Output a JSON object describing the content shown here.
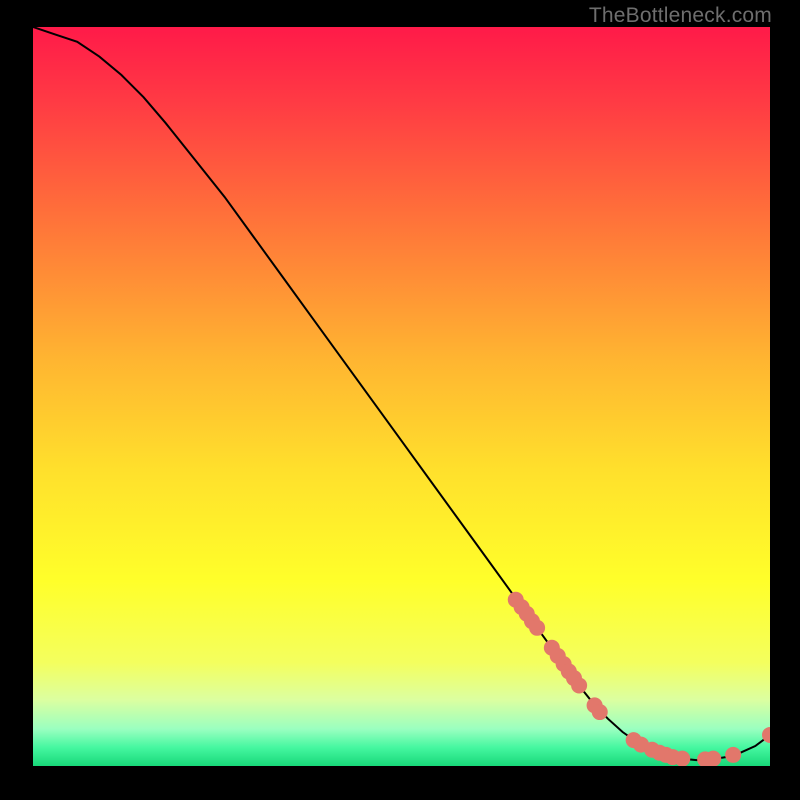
{
  "watermark": "TheBottleneck.com",
  "chart_data": {
    "type": "line",
    "title": "",
    "xlabel": "",
    "ylabel": "",
    "xlim": [
      0,
      100
    ],
    "ylim": [
      0,
      100
    ],
    "background_gradient": {
      "stops": [
        {
          "offset": 0.0,
          "color": "#ff1a49"
        },
        {
          "offset": 0.1,
          "color": "#ff3a44"
        },
        {
          "offset": 0.25,
          "color": "#ff6f3a"
        },
        {
          "offset": 0.45,
          "color": "#ffb531"
        },
        {
          "offset": 0.6,
          "color": "#ffe02c"
        },
        {
          "offset": 0.75,
          "color": "#ffff2a"
        },
        {
          "offset": 0.86,
          "color": "#f4ff5e"
        },
        {
          "offset": 0.91,
          "color": "#dcffa0"
        },
        {
          "offset": 0.95,
          "color": "#9affc0"
        },
        {
          "offset": 0.975,
          "color": "#45f7a0"
        },
        {
          "offset": 1.0,
          "color": "#18d879"
        }
      ]
    },
    "series": [
      {
        "name": "bottleneck-curve",
        "type": "line",
        "color": "#000000",
        "x": [
          0,
          3,
          6,
          9,
          12,
          15,
          18,
          22,
          26,
          30,
          34,
          38,
          42,
          46,
          50,
          54,
          58,
          62,
          66,
          70,
          74,
          76,
          78,
          80,
          82,
          84,
          86,
          88,
          90,
          92,
          94,
          96,
          98,
          100
        ],
        "y": [
          100,
          99,
          98,
          96,
          93.5,
          90.5,
          87,
          82,
          77,
          71.5,
          66,
          60.5,
          55,
          49.5,
          44,
          38.5,
          33,
          27.5,
          22,
          16.5,
          11,
          8.5,
          6.4,
          4.6,
          3.2,
          2.2,
          1.5,
          1.0,
          0.8,
          0.9,
          1.2,
          1.8,
          2.7,
          4.2
        ]
      },
      {
        "name": "highlighted-points",
        "type": "scatter",
        "color": "#e2776b",
        "radius": 8,
        "points": [
          {
            "x": 65.5,
            "y": 22.5
          },
          {
            "x": 66.3,
            "y": 21.5
          },
          {
            "x": 67.0,
            "y": 20.6
          },
          {
            "x": 67.7,
            "y": 19.6
          },
          {
            "x": 68.4,
            "y": 18.7
          },
          {
            "x": 70.4,
            "y": 16.0
          },
          {
            "x": 71.2,
            "y": 14.9
          },
          {
            "x": 72.0,
            "y": 13.8
          },
          {
            "x": 72.7,
            "y": 12.8
          },
          {
            "x": 73.4,
            "y": 11.9
          },
          {
            "x": 74.1,
            "y": 10.9
          },
          {
            "x": 76.2,
            "y": 8.2
          },
          {
            "x": 76.9,
            "y": 7.3
          },
          {
            "x": 81.5,
            "y": 3.5
          },
          {
            "x": 82.5,
            "y": 2.9
          },
          {
            "x": 84.0,
            "y": 2.2
          },
          {
            "x": 85.0,
            "y": 1.8
          },
          {
            "x": 85.9,
            "y": 1.5
          },
          {
            "x": 86.8,
            "y": 1.2
          },
          {
            "x": 88.1,
            "y": 1.0
          },
          {
            "x": 91.2,
            "y": 0.9
          },
          {
            "x": 92.3,
            "y": 1.0
          },
          {
            "x": 95.0,
            "y": 1.5
          },
          {
            "x": 100.0,
            "y": 4.2
          }
        ]
      }
    ]
  }
}
